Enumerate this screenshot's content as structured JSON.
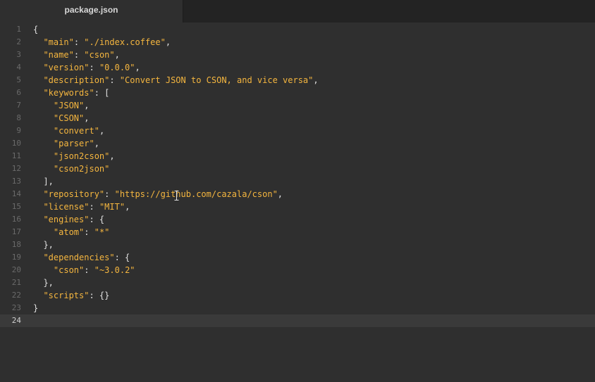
{
  "tab": {
    "title": "package.json"
  },
  "editor": {
    "current_line": 24,
    "lines": [
      {
        "n": "1",
        "indent": "",
        "parts": [
          [
            "p",
            "{"
          ]
        ]
      },
      {
        "n": "2",
        "indent": "  ",
        "parts": [
          [
            "s",
            "\"main\""
          ],
          [
            "p",
            ": "
          ],
          [
            "s",
            "\"./index.coffee\""
          ],
          [
            "p",
            ","
          ]
        ]
      },
      {
        "n": "3",
        "indent": "  ",
        "parts": [
          [
            "s",
            "\"name\""
          ],
          [
            "p",
            ": "
          ],
          [
            "s",
            "\"cson\""
          ],
          [
            "p",
            ","
          ]
        ]
      },
      {
        "n": "4",
        "indent": "  ",
        "parts": [
          [
            "s",
            "\"version\""
          ],
          [
            "p",
            ": "
          ],
          [
            "s",
            "\"0.0.0\""
          ],
          [
            "p",
            ","
          ]
        ]
      },
      {
        "n": "5",
        "indent": "  ",
        "parts": [
          [
            "s",
            "\"description\""
          ],
          [
            "p",
            ": "
          ],
          [
            "s",
            "\"Convert JSON to CSON, and vice versa\""
          ],
          [
            "p",
            ","
          ]
        ]
      },
      {
        "n": "6",
        "indent": "  ",
        "parts": [
          [
            "s",
            "\"keywords\""
          ],
          [
            "p",
            ": ["
          ]
        ]
      },
      {
        "n": "7",
        "indent": "    ",
        "parts": [
          [
            "s",
            "\"JSON\""
          ],
          [
            "p",
            ","
          ]
        ]
      },
      {
        "n": "8",
        "indent": "    ",
        "parts": [
          [
            "s",
            "\"CSON\""
          ],
          [
            "p",
            ","
          ]
        ]
      },
      {
        "n": "9",
        "indent": "    ",
        "parts": [
          [
            "s",
            "\"convert\""
          ],
          [
            "p",
            ","
          ]
        ]
      },
      {
        "n": "10",
        "indent": "    ",
        "parts": [
          [
            "s",
            "\"parser\""
          ],
          [
            "p",
            ","
          ]
        ]
      },
      {
        "n": "11",
        "indent": "    ",
        "parts": [
          [
            "s",
            "\"json2cson\""
          ],
          [
            "p",
            ","
          ]
        ]
      },
      {
        "n": "12",
        "indent": "    ",
        "parts": [
          [
            "s",
            "\"cson2json\""
          ]
        ]
      },
      {
        "n": "13",
        "indent": "  ",
        "parts": [
          [
            "p",
            "],"
          ]
        ]
      },
      {
        "n": "14",
        "indent": "  ",
        "parts": [
          [
            "s",
            "\"repository\""
          ],
          [
            "p",
            ": "
          ],
          [
            "s",
            "\"https://github.com/cazala/cson\""
          ],
          [
            "p",
            ","
          ]
        ]
      },
      {
        "n": "15",
        "indent": "  ",
        "parts": [
          [
            "s",
            "\"license\""
          ],
          [
            "p",
            ": "
          ],
          [
            "s",
            "\"MIT\""
          ],
          [
            "p",
            ","
          ]
        ]
      },
      {
        "n": "16",
        "indent": "  ",
        "parts": [
          [
            "s",
            "\"engines\""
          ],
          [
            "p",
            ": {"
          ]
        ]
      },
      {
        "n": "17",
        "indent": "    ",
        "parts": [
          [
            "s",
            "\"atom\""
          ],
          [
            "p",
            ": "
          ],
          [
            "s",
            "\"*\""
          ]
        ]
      },
      {
        "n": "18",
        "indent": "  ",
        "parts": [
          [
            "p",
            "},"
          ]
        ]
      },
      {
        "n": "19",
        "indent": "  ",
        "parts": [
          [
            "s",
            "\"dependencies\""
          ],
          [
            "p",
            ": {"
          ]
        ]
      },
      {
        "n": "20",
        "indent": "    ",
        "parts": [
          [
            "s",
            "\"cson\""
          ],
          [
            "p",
            ": "
          ],
          [
            "s",
            "\"~3.0.2\""
          ]
        ]
      },
      {
        "n": "21",
        "indent": "  ",
        "parts": [
          [
            "p",
            "},"
          ]
        ]
      },
      {
        "n": "22",
        "indent": "  ",
        "parts": [
          [
            "s",
            "\"scripts\""
          ],
          [
            "p",
            ": {}"
          ]
        ]
      },
      {
        "n": "23",
        "indent": "",
        "parts": [
          [
            "p",
            "}"
          ]
        ]
      },
      {
        "n": "24",
        "indent": "",
        "parts": []
      }
    ]
  },
  "colors": {
    "string": "#f5b63f",
    "punctuation": "#e0e0e0",
    "background": "#2f2f2f",
    "gutter_text": "#6a6a6a"
  }
}
